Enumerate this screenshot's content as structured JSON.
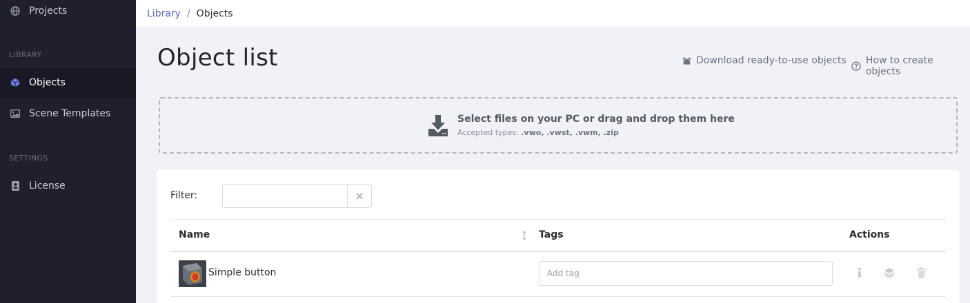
{
  "sidebar": {
    "items": [
      {
        "label": "Projects",
        "icon": "globe-icon"
      },
      {
        "label": "Objects",
        "icon": "cube-icon",
        "active": true
      },
      {
        "label": "Scene Templates",
        "icon": "image-icon"
      },
      {
        "label": "License",
        "icon": "id-card-icon"
      }
    ],
    "sections": {
      "library": "LIBRARY",
      "settings": "SETTINGS"
    }
  },
  "breadcrumb": {
    "parent": "Library",
    "separator": "/",
    "current": "Objects"
  },
  "header": {
    "title": "Object list",
    "download_link": "Download ready-to-use objects",
    "howto_link": "How to create objects"
  },
  "dropzone": {
    "main_text": "Select files on your PC or drag and drop them here",
    "accepted_label": "Accepted types:",
    "accepted_types": ".vwo, .vwst, .vwm, .zip"
  },
  "filter": {
    "label": "Filter:",
    "value": ""
  },
  "table": {
    "columns": [
      "Name",
      "Tags",
      "Actions"
    ],
    "rows": [
      {
        "name": "Simple button",
        "tag_placeholder": "Add tag"
      }
    ]
  },
  "colors": {
    "sidebar_bg": "#1f1f2e",
    "accent": "#5a6bbd",
    "page_bg": "#f0f2f7"
  }
}
